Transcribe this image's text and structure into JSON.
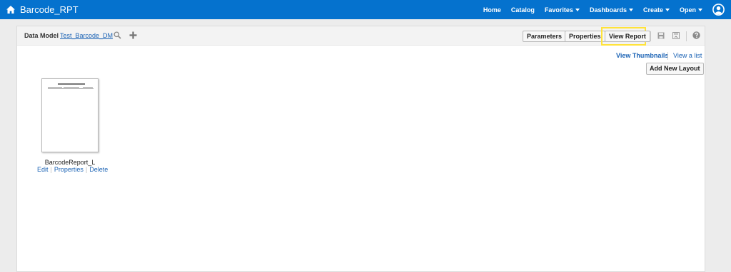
{
  "header": {
    "title": "Barcode_RPT",
    "nav": [
      {
        "label": "Home",
        "dropdown": false
      },
      {
        "label": "Catalog",
        "dropdown": false
      },
      {
        "label": "Favorites",
        "dropdown": true
      },
      {
        "label": "Dashboards",
        "dropdown": true
      },
      {
        "label": "Create",
        "dropdown": true
      },
      {
        "label": "Open",
        "dropdown": true
      }
    ],
    "colors": {
      "bar": "#0572ce",
      "text": "#ffffff"
    }
  },
  "toolbar": {
    "data_model_label": "Data Model",
    "data_model_link": "Test_Barcode_DM",
    "parameters_label": "Parameters",
    "properties_label": "Properties",
    "view_report_label": "View Report",
    "highlight_color": "#ffe33a"
  },
  "view_options": {
    "thumbnails_label": "View Thumbnails",
    "list_label": "View a list"
  },
  "add_layout_label": "Add New Layout",
  "layouts": [
    {
      "name": "BarcodeReport_L",
      "actions": [
        "Edit",
        "Properties",
        "Delete"
      ]
    }
  ],
  "icons": [
    "home-icon",
    "user-icon",
    "search-icon",
    "plus-icon",
    "save-icon",
    "save-as-icon",
    "help-icon"
  ]
}
